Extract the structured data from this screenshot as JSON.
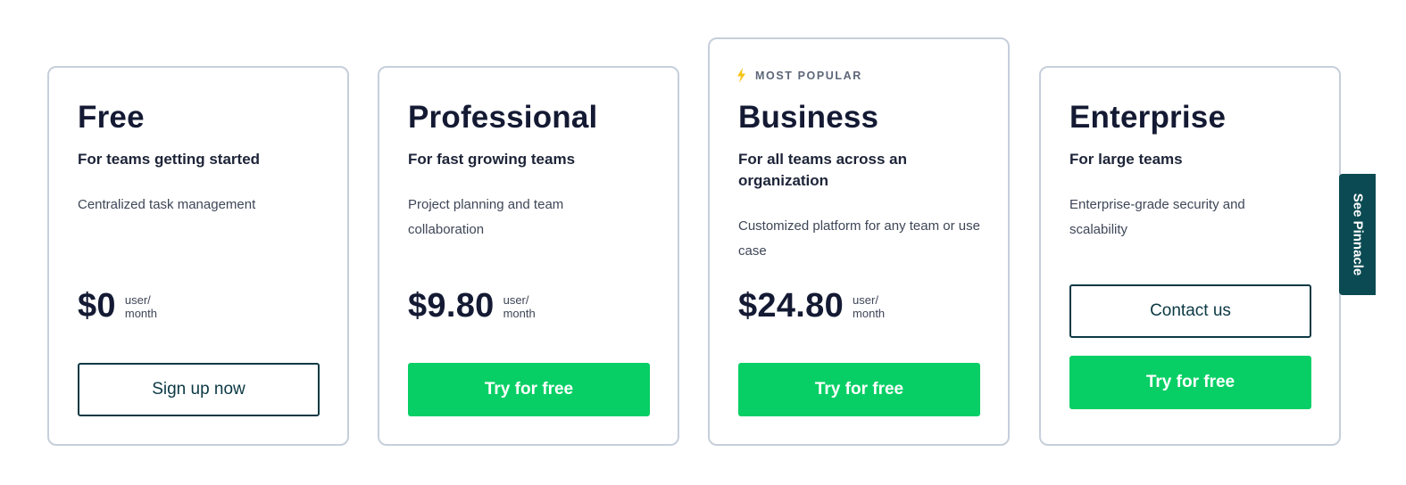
{
  "plans": [
    {
      "name": "Free",
      "tagline": "For teams getting started",
      "description": "Centralized task management",
      "price": "$0",
      "price_unit_line1": "user/",
      "price_unit_line2": "month",
      "buttons": [
        {
          "label": "Sign up now",
          "style": "outline"
        }
      ]
    },
    {
      "name": "Professional",
      "tagline": "For fast growing teams",
      "description": "Project planning and team collaboration",
      "price": "$9.80",
      "price_unit_line1": "user/",
      "price_unit_line2": "month",
      "buttons": [
        {
          "label": "Try for free",
          "style": "primary"
        }
      ]
    },
    {
      "badge": {
        "icon": "lightning-bolt-icon",
        "label": "MOST POPULAR"
      },
      "name": "Business",
      "tagline": "For all teams across an organization",
      "description": "Customized platform for any team or use case",
      "price": "$24.80",
      "price_unit_line1": "user/",
      "price_unit_line2": "month",
      "buttons": [
        {
          "label": "Try for free",
          "style": "primary"
        }
      ]
    },
    {
      "name": "Enterprise",
      "tagline": "For large teams",
      "description": "Enterprise-grade security and scalability",
      "buttons": [
        {
          "label": "Contact us",
          "style": "outline"
        },
        {
          "label": "Try for free",
          "style": "primary"
        }
      ]
    }
  ],
  "side_tab": {
    "label": "See Pinnacle"
  },
  "colors": {
    "primary_button": "#08cf65",
    "outline_button_border": "#0b3944",
    "card_border": "#c6cfdb",
    "side_tab_bg": "#0b4a52",
    "badge_icon": "#f5c518"
  }
}
